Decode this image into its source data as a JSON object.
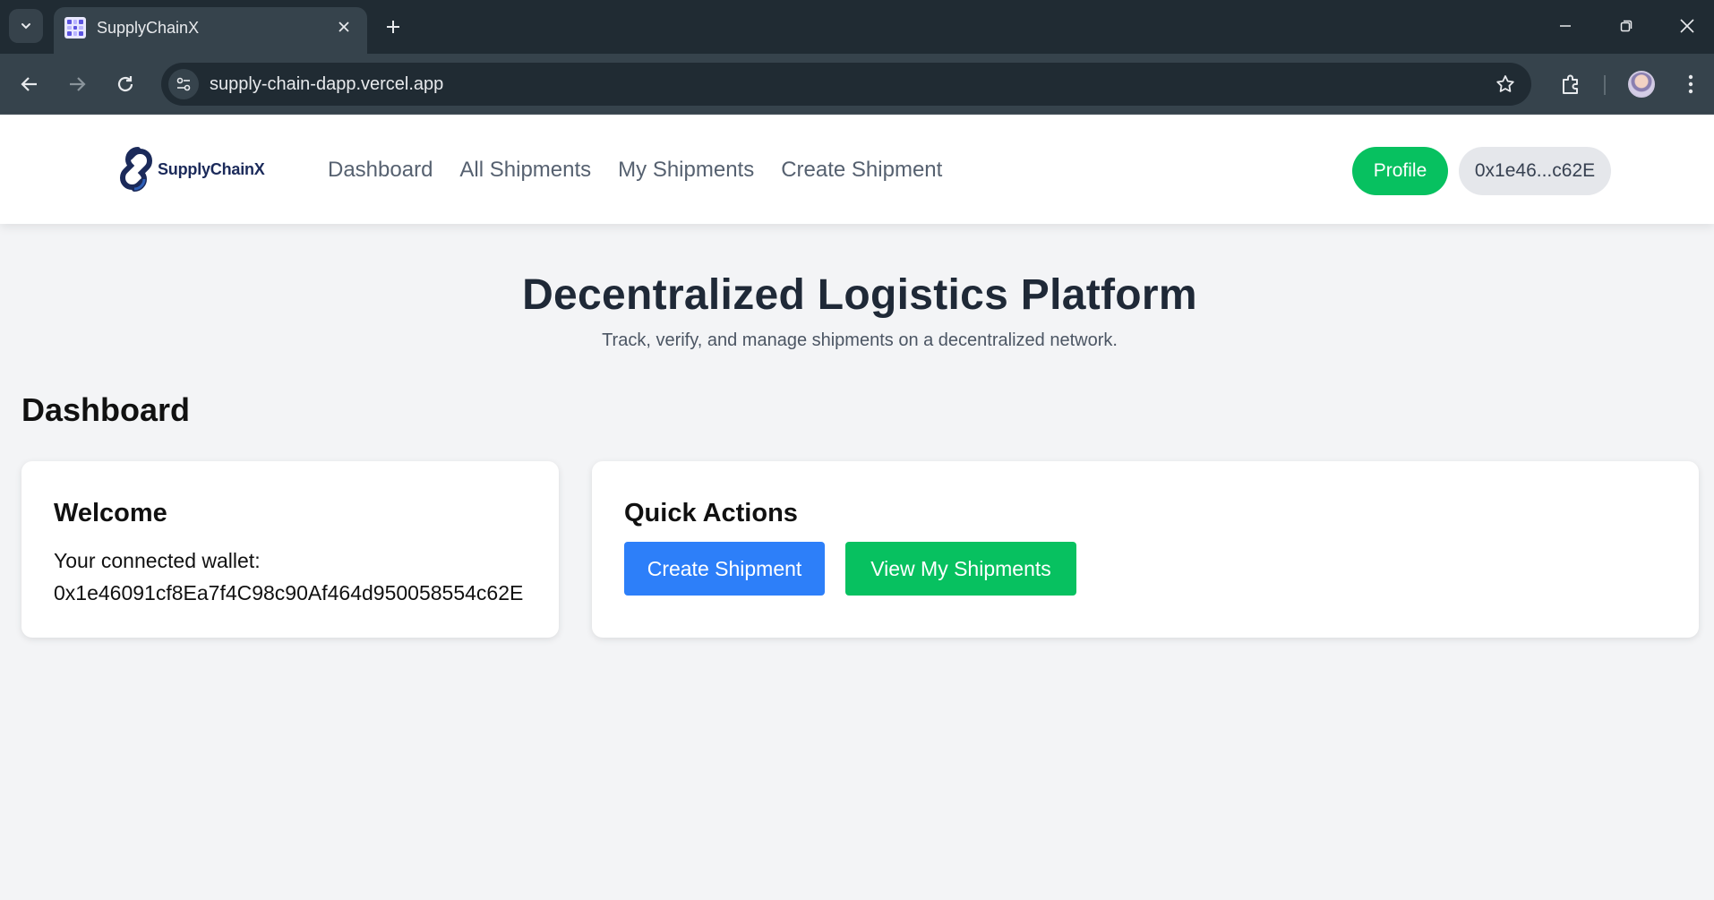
{
  "browser": {
    "tab_title": "SupplyChainX",
    "url": "supply-chain-dapp.vercel.app"
  },
  "header": {
    "logo_text": "SupplyChainX",
    "nav": [
      {
        "label": "Dashboard"
      },
      {
        "label": "All Shipments"
      },
      {
        "label": "My Shipments"
      },
      {
        "label": "Create Shipment"
      }
    ],
    "profile_label": "Profile",
    "wallet_short": "0x1e46...c62E"
  },
  "hero": {
    "title": "Decentralized Logistics Platform",
    "subtitle": "Track, verify, and manage shipments on a decentralized network."
  },
  "dashboard": {
    "title": "Dashboard",
    "welcome": {
      "title": "Welcome",
      "label": "Your connected wallet:",
      "address": "0x1e46091cf8Ea7f4C98c90Af464d950058554c62E"
    },
    "quick_actions": {
      "title": "Quick Actions",
      "create_label": "Create Shipment",
      "view_label": "View My Shipments"
    }
  },
  "colors": {
    "green": "#07c160",
    "blue": "#2d7ff9",
    "page_bg": "#f3f4f6",
    "chrome_dark": "#202b33"
  }
}
